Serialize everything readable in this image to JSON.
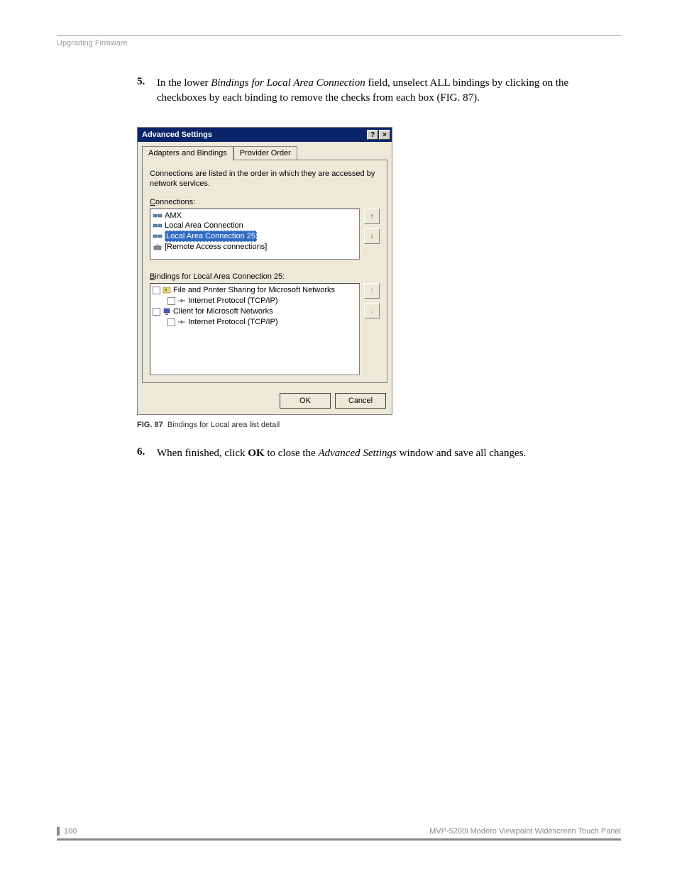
{
  "header": {
    "section": "Upgrading Firmware"
  },
  "steps": {
    "s5": {
      "num": "5.",
      "pre": "In the lower ",
      "field": "Bindings for Local Area Connection",
      "post": " field, unselect ALL bindings by clicking on the checkboxes by each binding to remove the checks from each box (FIG. 87)."
    },
    "s6": {
      "num": "6.",
      "pre": "When finished, click ",
      "ok": "OK",
      "mid": " to close the ",
      "win": "Advanced Settings",
      "post": " window and save all changes."
    }
  },
  "dialog": {
    "title": "Advanced Settings",
    "help": "?",
    "close": "×",
    "tabs": {
      "t1": "Adapters and Bindings",
      "t2": "Provider Order"
    },
    "desc": "Connections are listed in the order in which they are accessed by network services.",
    "connLabel": "Connections:",
    "connLabelU": "C",
    "connections": [
      {
        "label": "AMX"
      },
      {
        "label": "Local Area Connection"
      },
      {
        "label": "Local Area Connection 25",
        "selected": true
      },
      {
        "label": "[Remote Access connections]"
      }
    ],
    "bindingsLabel": "Bindings for Local Area Connection 25:",
    "bindingsLabelU": "B",
    "bindings": [
      {
        "label": "File and Printer Sharing for Microsoft Networks",
        "level": 0
      },
      {
        "label": "Internet Protocol (TCP/IP)",
        "level": 1
      },
      {
        "label": "Client for Microsoft Networks",
        "level": 0
      },
      {
        "label": "Internet Protocol (TCP/IP)",
        "level": 1
      }
    ],
    "buttons": {
      "ok": "OK",
      "cancel": "Cancel"
    },
    "arrows": {
      "up": "↑",
      "down": "↓"
    }
  },
  "figure": {
    "label": "FIG. 87",
    "caption": "Bindings for Local area list detail"
  },
  "footer": {
    "page": "100",
    "product": "MVP-5200i Modero Viewpoint Widescreen Touch Panel"
  }
}
